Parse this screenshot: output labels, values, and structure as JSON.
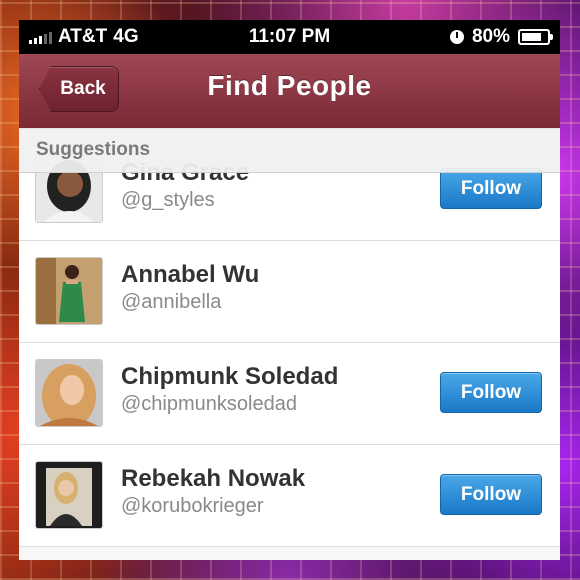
{
  "status_bar": {
    "carrier": "AT&T",
    "network": "4G",
    "time": "11:07 PM",
    "battery_percent": "80%",
    "battery_level": 0.8
  },
  "nav": {
    "back_label": "Back",
    "title": "Find People"
  },
  "section": {
    "title": "Suggestions"
  },
  "people": [
    {
      "name": "Gina Grace",
      "handle": "@g_styles",
      "follow_label": "Follow",
      "avatar_icon": "profile-photo"
    },
    {
      "name": "Annabel Wu",
      "handle": "@annibella",
      "follow_label": "",
      "avatar_icon": "profile-photo"
    },
    {
      "name": "Chipmunk Soledad",
      "handle": "@chipmunksoledad",
      "follow_label": "Follow",
      "avatar_icon": "profile-photo"
    },
    {
      "name": "Rebekah Nowak",
      "handle": "@korubokrieger",
      "follow_label": "Follow",
      "avatar_icon": "profile-photo"
    }
  ],
  "colors": {
    "nav_bar": "#8e3a46",
    "follow_button": "#2a8ad8"
  }
}
